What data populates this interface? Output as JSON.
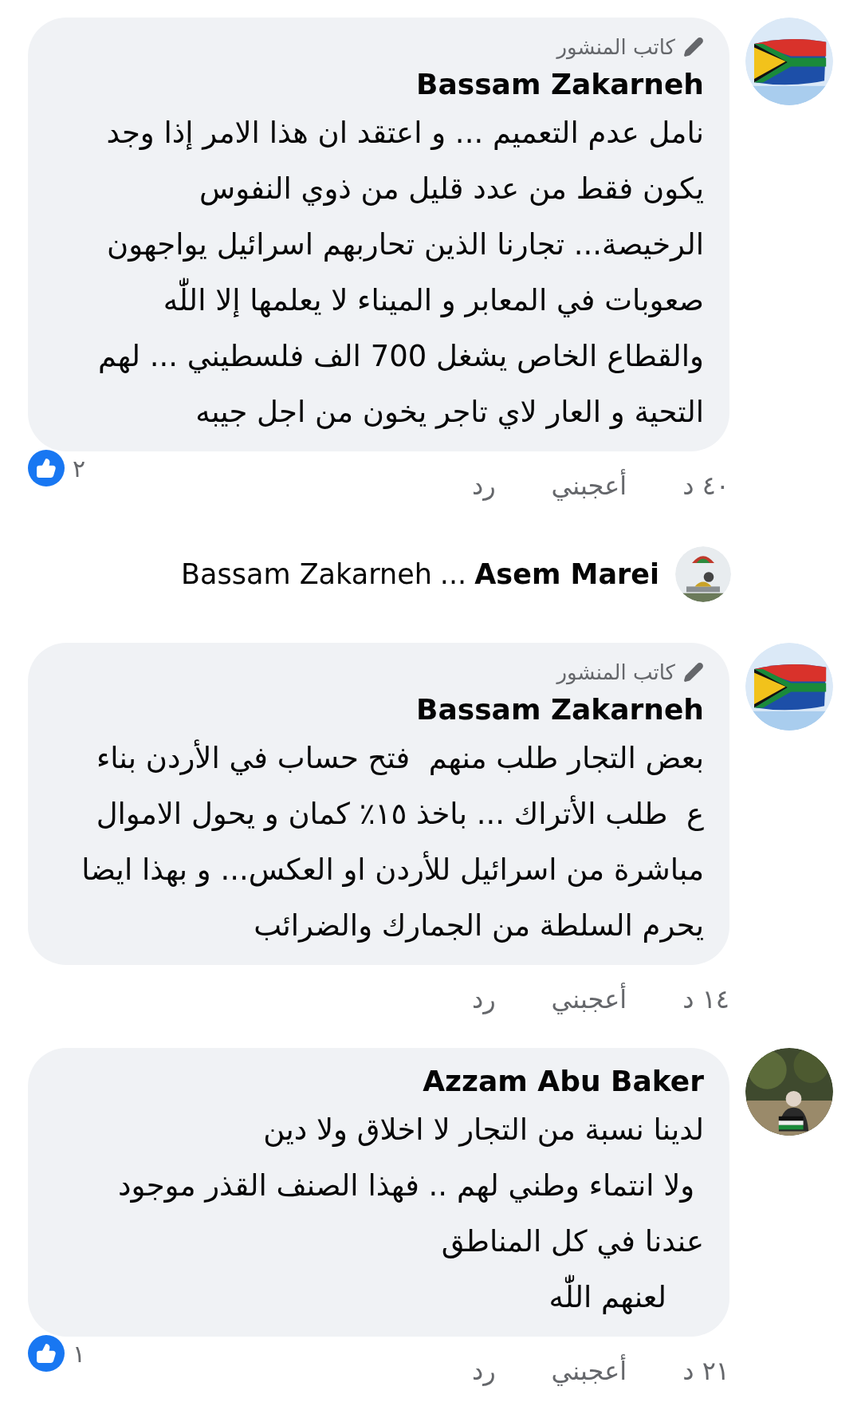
{
  "comments": [
    {
      "kind": "comment",
      "author_badge": "كاتب المنشور",
      "author": "Bassam Zakarneh",
      "lines": [
        "نامل عدم التعميم ... و اعتقد ان هذا الامر إذا وجد",
        "يكون فقط من عدد قليل من ذوي النفوس",
        "الرخيصة... تجارنا الذين تحاربهم اسرائيل يواجهون",
        "صعوبات في المعابر و الميناء لا يعلمها إلا اللّٰه",
        "والقطاع الخاص يشغل 700 الف فلسطيني ... لهم",
        "التحية و العار لاي تاجر يخون من اجل جيبه"
      ],
      "time": "٤٠ د",
      "like": "أعجبني",
      "reply": "رد",
      "reactions": "٢"
    },
    {
      "kind": "reply_summary",
      "author": "Asem Marei",
      "separator": "...",
      "reply_to": "Bassam Zakarneh"
    },
    {
      "kind": "comment",
      "author_badge": "كاتب المنشور",
      "author": "Bassam Zakarneh",
      "lines": [
        "بعض التجار طلب منهم  فتح حساب في الأردن بناء",
        "ع  طلب الأتراك ... باخذ ١٥٪ كمان و يحول الاموال",
        "مباشرة من اسرائيل للأردن او العكس... و بهذا ايضا",
        "يحرم السلطة من الجمارك والضرائب"
      ],
      "time": "١٤ د",
      "like": "أعجبني",
      "reply": "رد"
    },
    {
      "kind": "comment",
      "author": "Azzam Abu Baker",
      "lines": [
        "لدينا نسبة من التجار لا اخلاق ولا دين",
        " ولا انتماء وطني لهم .. فهذا الصنف القذر موجود",
        "عندنا في كل المناطق",
        "    لعنهم اللّٰه"
      ],
      "time": "٢١ د",
      "like": "أعجبني",
      "reply": "رد",
      "reactions": "١"
    }
  ]
}
